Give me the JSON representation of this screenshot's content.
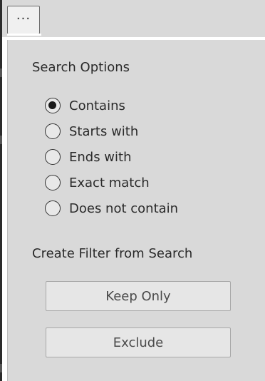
{
  "toolbar": {
    "more_icon": "more-horizontal-icon",
    "more_glyph": "···"
  },
  "search_options": {
    "title": "Search Options",
    "options": [
      {
        "label": "Contains",
        "selected": true
      },
      {
        "label": "Starts with",
        "selected": false
      },
      {
        "label": "Ends with",
        "selected": false
      },
      {
        "label": "Exact match",
        "selected": false
      },
      {
        "label": "Does not contain",
        "selected": false
      }
    ]
  },
  "filter": {
    "title": "Create Filter from Search",
    "keep_only_label": "Keep Only",
    "exclude_label": "Exclude"
  }
}
